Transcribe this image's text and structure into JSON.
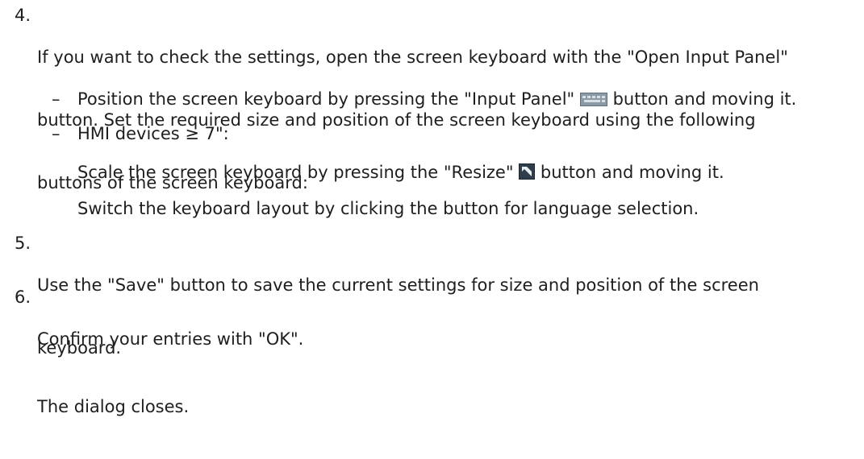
{
  "steps": [
    {
      "number": "4.",
      "text": "If you want to check the settings, open the screen keyboard with the \"Open Input Panel\" button. Set the required size and position of the screen keyboard using the following buttons of the screen keyboard:",
      "line1": "If you want to check the settings, open the screen keyboard with the \"Open Input Panel\"",
      "line2": "button. Set the required size and position of the screen keyboard using the following",
      "line3": "buttons of the screen keyboard:",
      "bullets": [
        {
          "dash": "–",
          "before_icon": "Position the screen keyboard by pressing the \"Input Panel\"",
          "icon": "input-panel-icon",
          "after_icon": "button and moving it."
        },
        {
          "dash": "–",
          "text": "HMI devices ≥ 7\":"
        }
      ],
      "indented": [
        {
          "before_icon": "Scale the screen keyboard by pressing the \"Resize\"",
          "icon": "resize-icon",
          "after_icon": "button and moving it."
        },
        {
          "text": "Switch the keyboard layout by clicking the button for language selection."
        }
      ]
    },
    {
      "number": "5.",
      "line1": "Use the \"Save\" button to save the current settings for size and position of the screen",
      "line2": "keyboard."
    },
    {
      "number": "6.",
      "line1": "Confirm your entries with \"OK\".",
      "result": "The dialog closes."
    }
  ]
}
